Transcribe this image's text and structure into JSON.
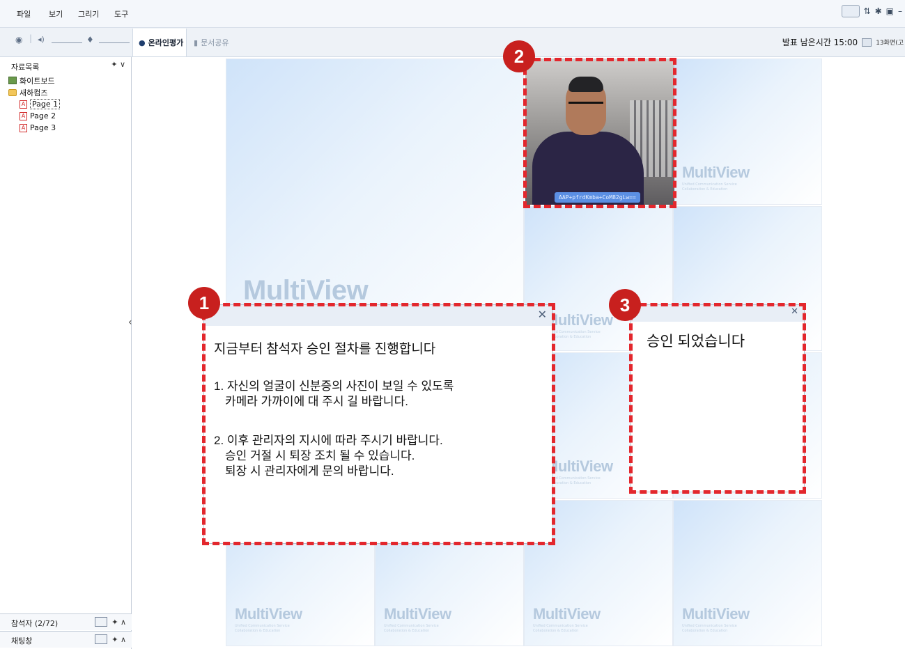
{
  "menubar": {
    "items": [
      "파일",
      "보기",
      "그리기",
      "도구"
    ],
    "right_icons": [
      "window-icon",
      "sort-icon",
      "gear-icon",
      "fullscreen-icon",
      "minimize-icon"
    ]
  },
  "toolbar": {
    "tabs": [
      {
        "label": "온라인평가",
        "active": true
      },
      {
        "label": "문서공유",
        "active": false
      }
    ],
    "timer_label": "발표 남은시간 15:00",
    "screen_mode": "13화면(고"
  },
  "left_panel": {
    "title": "자료목록",
    "tree": [
      {
        "label": "화이트보드",
        "type": "whiteboard"
      },
      {
        "label": "새하컴즈",
        "type": "folder"
      },
      {
        "label": "Page 1",
        "type": "pdf",
        "selected": true
      },
      {
        "label": "Page 2",
        "type": "pdf"
      },
      {
        "label": "Page 3",
        "type": "pdf"
      }
    ],
    "participants_label": "참석자 (2/72)",
    "chat_label": "채팅창"
  },
  "tiles": {
    "watermark": "MultiView",
    "watermark_sub": "Unified Communication Service",
    "watermark_sub2": "Collaboration & Education"
  },
  "webcam": {
    "id_text": "AAP+pfrdKmba+CoM82gLw=="
  },
  "dialog1": {
    "line1": "지금부터 참석자 승인 절차를 진행합니다",
    "line2": "1. 자신의 얼굴이 신분증의 사진이 보일 수 있도록",
    "line3": "카메라 가까이에 대 주시 길 바랍니다.",
    "line4": "2. 이후 관리자의 지시에 따라 주시기 바랍니다.",
    "line5": "승인 거절 시 퇴장 조치 될 수 있습니다.",
    "line6": "퇴장 시 관리자에게 문의 바랍니다."
  },
  "dialog3": {
    "text": "승인 되었습니다"
  },
  "badges": [
    "1",
    "2",
    "3"
  ],
  "colors": {
    "highlight": "#e3272d",
    "badge": "#c8201e",
    "tile_blue": "#cfe3f9"
  }
}
